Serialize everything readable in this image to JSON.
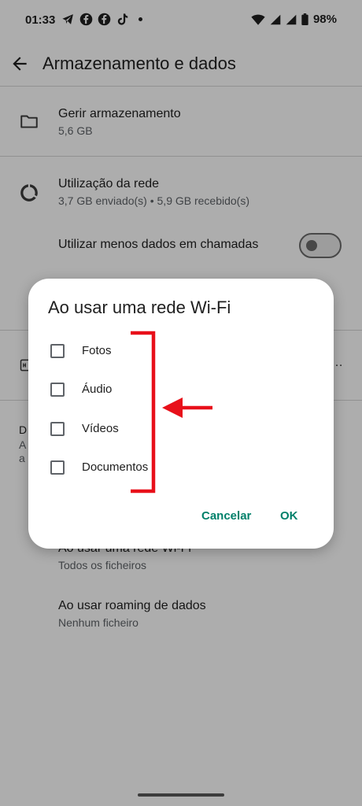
{
  "status_bar": {
    "time": "01:33",
    "battery": "98%",
    "icons": [
      "telegram-icon",
      "facebook-icon",
      "facebook-icon",
      "tiktok-icon"
    ]
  },
  "app_bar": {
    "title": "Armazenamento e dados"
  },
  "items": {
    "manage_storage": {
      "title": "Gerir armazenamento",
      "sub": "5,6 GB"
    },
    "network_usage": {
      "title": "Utilização da rede",
      "sub": "3,7 GB enviado(s) • 5,9 GB recebido(s)"
    },
    "less_data": {
      "title": "Utilizar menos dados em chamadas",
      "enabled": false
    },
    "partial_ellipsis": "…",
    "partial_letters": [
      "D",
      "A",
      "a"
    ],
    "wifi": {
      "title": "Ao usar uma rede Wi-Fi",
      "sub": "Todos os ficheiros"
    },
    "roaming": {
      "title": "Ao usar roaming de dados",
      "sub": "Nenhum ficheiro"
    }
  },
  "dialog": {
    "title": "Ao usar uma rede Wi-Fi",
    "options": [
      {
        "label": "Fotos",
        "checked": false
      },
      {
        "label": "Áudio",
        "checked": false
      },
      {
        "label": "Vídeos",
        "checked": false
      },
      {
        "label": "Documentos",
        "checked": false
      }
    ],
    "cancel_label": "Cancelar",
    "ok_label": "OK"
  },
  "colors": {
    "accent": "#00806a",
    "annotation": "#e8101a"
  }
}
